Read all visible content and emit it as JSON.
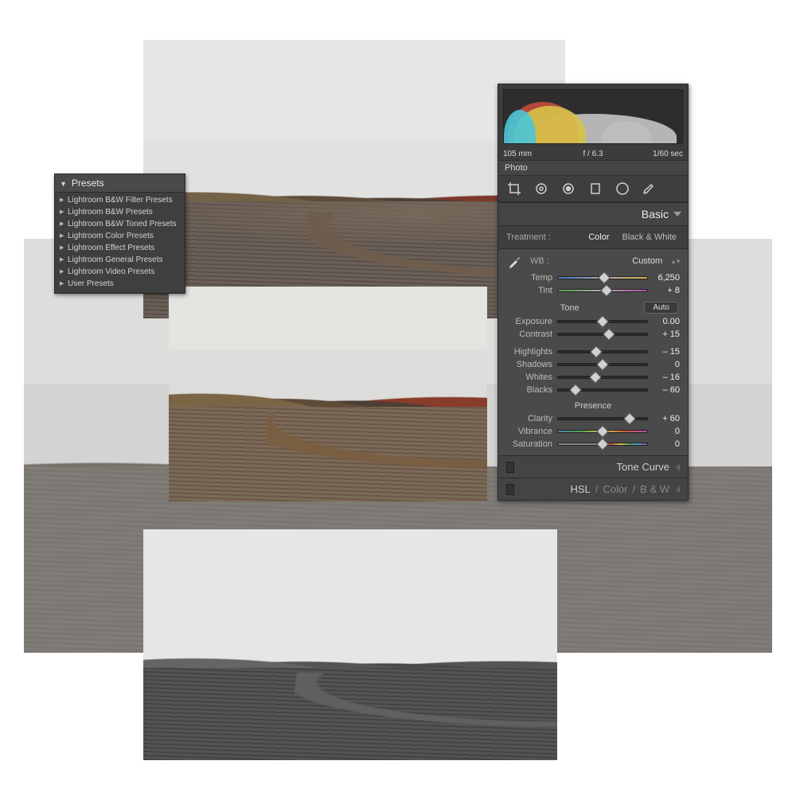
{
  "presets": {
    "title": "Presets",
    "items": [
      "Lightroom B&W Filter Presets",
      "Lightroom B&W Presets",
      "Lightroom B&W Toned Presets",
      "Lightroom Color Presets",
      "Lightroom Effect Presets",
      "Lightroom General Presets",
      "Lightroom Video Presets",
      "User Presets"
    ]
  },
  "histogram": {
    "focal": "105 mm",
    "aperture": "f / 6.3",
    "shutter": "1/60 sec",
    "label_photo": "Photo"
  },
  "panel": {
    "basic_title": "Basic",
    "treatment_label": "Treatment :",
    "treatment_color": "Color",
    "treatment_bw": "Black & White",
    "wb_label": "WB :",
    "wb_value": "Custom",
    "tone_title": "Tone",
    "auto_label": "Auto",
    "presence_title": "Presence",
    "tonecurve_title": "Tone Curve",
    "hsl_title": "HSL",
    "hsl_sep": "/",
    "hsl_color": "Color",
    "hsl_bw": "B & W"
  },
  "sliders": {
    "temp": {
      "label": "Temp",
      "value": "6,250",
      "pos": 52
    },
    "tint": {
      "label": "Tint",
      "value": "+ 8",
      "pos": 54
    },
    "exposure": {
      "label": "Exposure",
      "value": "0.00",
      "pos": 50
    },
    "contrast": {
      "label": "Contrast",
      "value": "+ 15",
      "pos": 57
    },
    "highlights": {
      "label": "Highlights",
      "value": "– 15",
      "pos": 43
    },
    "shadows": {
      "label": "Shadows",
      "value": "0",
      "pos": 50
    },
    "whites": {
      "label": "Whites",
      "value": "– 16",
      "pos": 42
    },
    "blacks": {
      "label": "Blacks",
      "value": "– 60",
      "pos": 20
    },
    "clarity": {
      "label": "Clarity",
      "value": "+ 60",
      "pos": 80
    },
    "vibrance": {
      "label": "Vibrance",
      "value": "0",
      "pos": 50
    },
    "saturation": {
      "label": "Saturation",
      "value": "0",
      "pos": 50
    }
  }
}
